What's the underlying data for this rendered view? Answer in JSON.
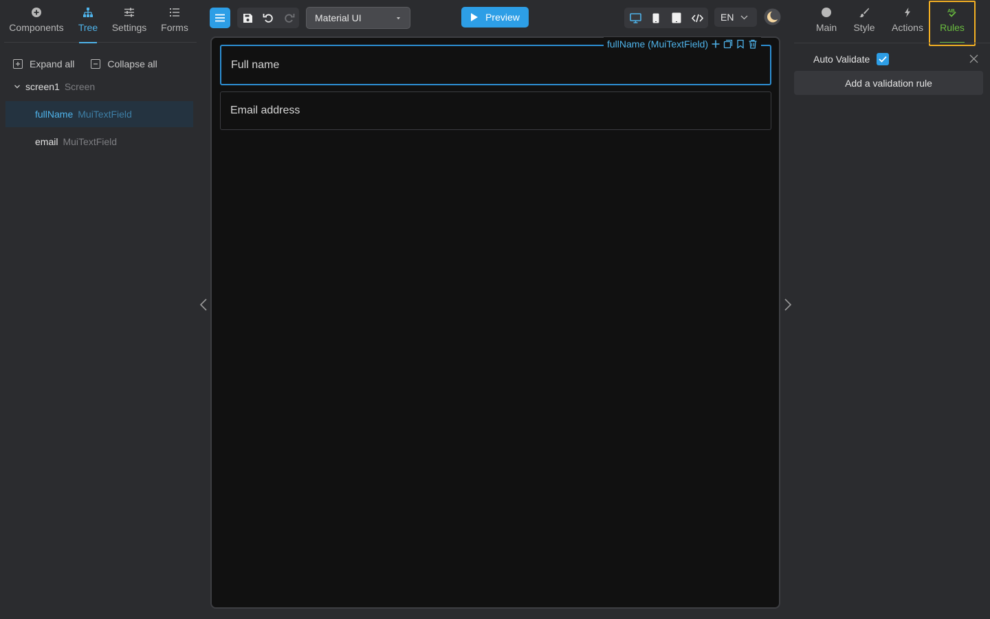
{
  "left_tabs": [
    {
      "label": "Components",
      "icon": "plus-circle-icon"
    },
    {
      "label": "Tree",
      "icon": "tree-icon",
      "active": true
    },
    {
      "label": "Settings",
      "icon": "sliders-icon"
    },
    {
      "label": "Forms",
      "icon": "list-icon"
    }
  ],
  "tree": {
    "expand_all": "Expand all",
    "collapse_all": "Collapse all",
    "root": {
      "name": "screen1",
      "type": "Screen"
    },
    "children": [
      {
        "name": "fullName",
        "type": "MuiTextField",
        "selected": true
      },
      {
        "name": "email",
        "type": "MuiTextField"
      }
    ]
  },
  "toolbar": {
    "library": "Material UI",
    "preview": "Preview",
    "language": "EN"
  },
  "canvas": {
    "selection_label": "fullName (MuiTextField)",
    "fields": [
      {
        "placeholder": "Full name"
      },
      {
        "placeholder": "Email address"
      }
    ]
  },
  "right_tabs": [
    {
      "label": "Main",
      "icon": "circle-icon"
    },
    {
      "label": "Style",
      "icon": "brush-icon"
    },
    {
      "label": "Actions",
      "icon": "lightning-icon"
    },
    {
      "label": "Rules",
      "icon": "spellcheck-icon",
      "active": true
    }
  ],
  "rules_panel": {
    "auto_validate_label": "Auto Validate",
    "auto_validate_checked": true,
    "add_rule_label": "Add a validation rule"
  },
  "colors": {
    "accent": "#2d9ee6",
    "rules_green": "#6abd3f",
    "highlight": "#f4b023"
  }
}
